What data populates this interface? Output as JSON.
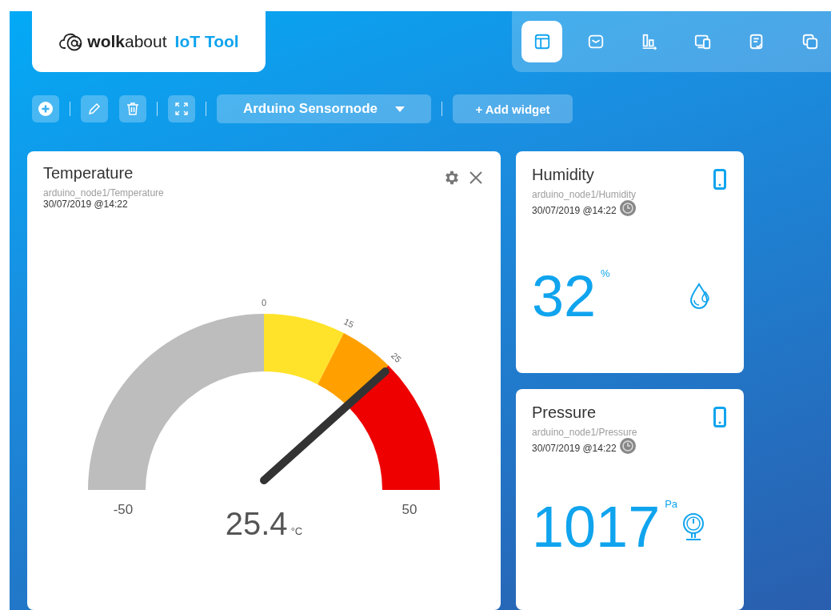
{
  "logo": {
    "brand": "**wolk**about",
    "product": "IoT Tool"
  },
  "nav": [
    {
      "selected": true
    },
    {
      "selected": false
    },
    {
      "selected": false
    },
    {
      "selected": false
    },
    {
      "selected": false
    },
    {
      "selected": false
    }
  ],
  "toolbar": {
    "dashboard": "Arduino Sensornode",
    "add_widget": "+ Add widget"
  },
  "widgets": [
    {
      "kind": "gauge",
      "title": "Temperature",
      "path": "arduino_node1/Temperature",
      "timestamp": "30/07/2019 @14:22",
      "value": "25.4",
      "unit": "°C",
      "min_label": "-50",
      "max_label": "50",
      "segments": [
        {
          "color": "#bdbdbd",
          "end_label": "0"
        },
        {
          "color": "#ffe32a",
          "end_label": "15"
        },
        {
          "color": "#ffa000",
          "end_label": "25"
        },
        {
          "color": "#ee0000"
        }
      ]
    },
    {
      "kind": "value",
      "title": "Humidity",
      "path": "arduino_node1/Humidity",
      "timestamp": "30/07/2019 @14:22",
      "value": "32",
      "unit": "%"
    },
    {
      "kind": "value",
      "title": "Pressure",
      "path": "arduino_node1/Pressure",
      "timestamp": "30/07/2019 @14:22",
      "value": "1017",
      "unit": "Pa"
    }
  ]
}
